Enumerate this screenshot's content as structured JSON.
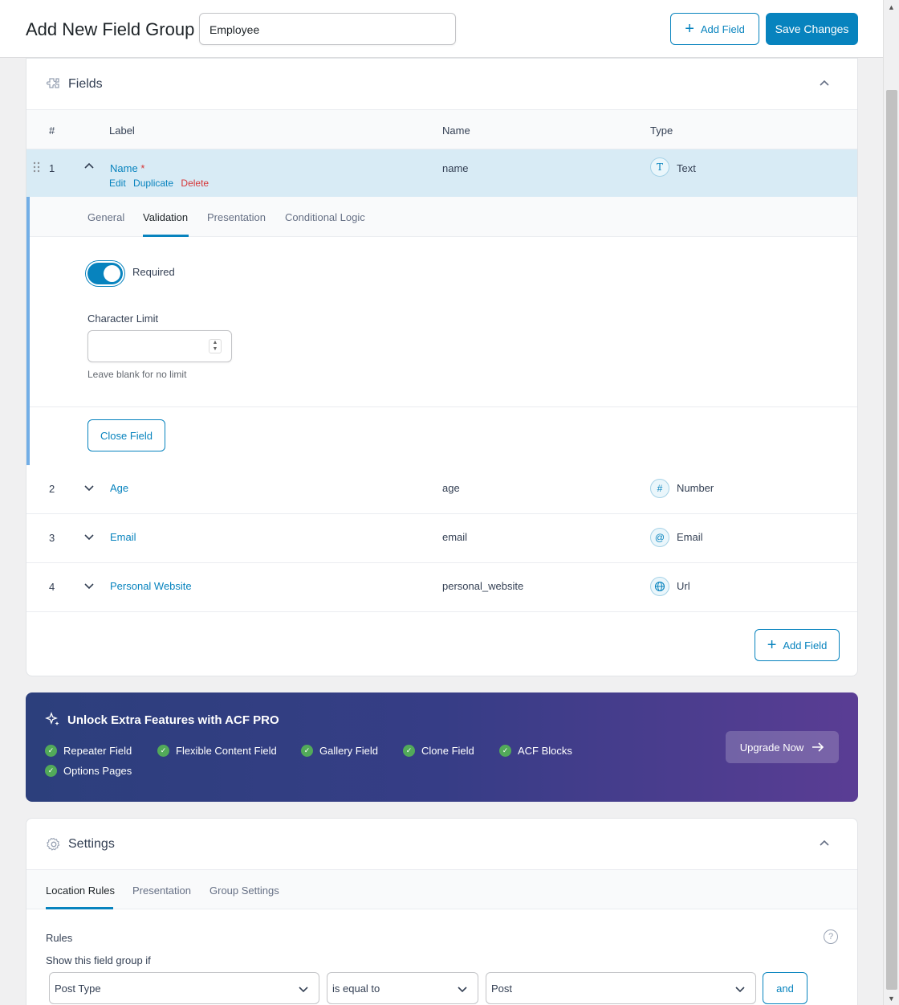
{
  "header": {
    "title": "Add New Field Group",
    "group_title_value": "Employee",
    "add_field_label": "Add Field",
    "save_label": "Save Changes"
  },
  "fields_panel": {
    "title": "Fields",
    "columns": {
      "num": "#",
      "label": "Label",
      "name": "Name",
      "type": "Type"
    },
    "rows": [
      {
        "num": "1",
        "label": "Name",
        "required_mark": "*",
        "name": "name",
        "type": "Text",
        "type_icon": "text-icon",
        "type_glyph": "T",
        "expanded": true
      },
      {
        "num": "2",
        "label": "Age",
        "name": "age",
        "type": "Number",
        "type_icon": "number-icon",
        "type_glyph": "#",
        "expanded": false
      },
      {
        "num": "3",
        "label": "Email",
        "name": "email",
        "type": "Email",
        "type_icon": "email-icon",
        "type_glyph": "@",
        "expanded": false
      },
      {
        "num": "4",
        "label": "Personal Website",
        "name": "personal_website",
        "type": "Url",
        "type_icon": "globe-icon",
        "type_glyph": "🌐",
        "expanded": false
      }
    ],
    "row_actions": {
      "edit": "Edit",
      "duplicate": "Duplicate",
      "delete": "Delete"
    },
    "field_tabs": [
      "General",
      "Validation",
      "Presentation",
      "Conditional Logic"
    ],
    "active_field_tab": "Validation",
    "required_label": "Required",
    "required_on": true,
    "char_limit_label": "Character Limit",
    "char_limit_value": "",
    "char_limit_hint": "Leave blank for no limit",
    "close_field_label": "Close Field",
    "add_field_label": "Add Field"
  },
  "promo": {
    "title": "Unlock Extra Features with ACF PRO",
    "features": [
      "Repeater Field",
      "Flexible Content Field",
      "Gallery Field",
      "Clone Field",
      "ACF Blocks",
      "Options Pages"
    ],
    "upgrade_label": "Upgrade Now"
  },
  "settings_panel": {
    "title": "Settings",
    "tabs": [
      "Location Rules",
      "Presentation",
      "Group Settings"
    ],
    "active_tab": "Location Rules",
    "rules_label": "Rules",
    "show_if_label": "Show this field group if",
    "help_glyph": "?",
    "rule": {
      "param": "Post Type",
      "operator": "is equal to",
      "value": "Post"
    },
    "and_label": "and"
  },
  "colors": {
    "accent": "#0783be",
    "danger": "#d63638",
    "expanded_row_bg": "#d8ebf5",
    "check_green": "#52aa59"
  }
}
